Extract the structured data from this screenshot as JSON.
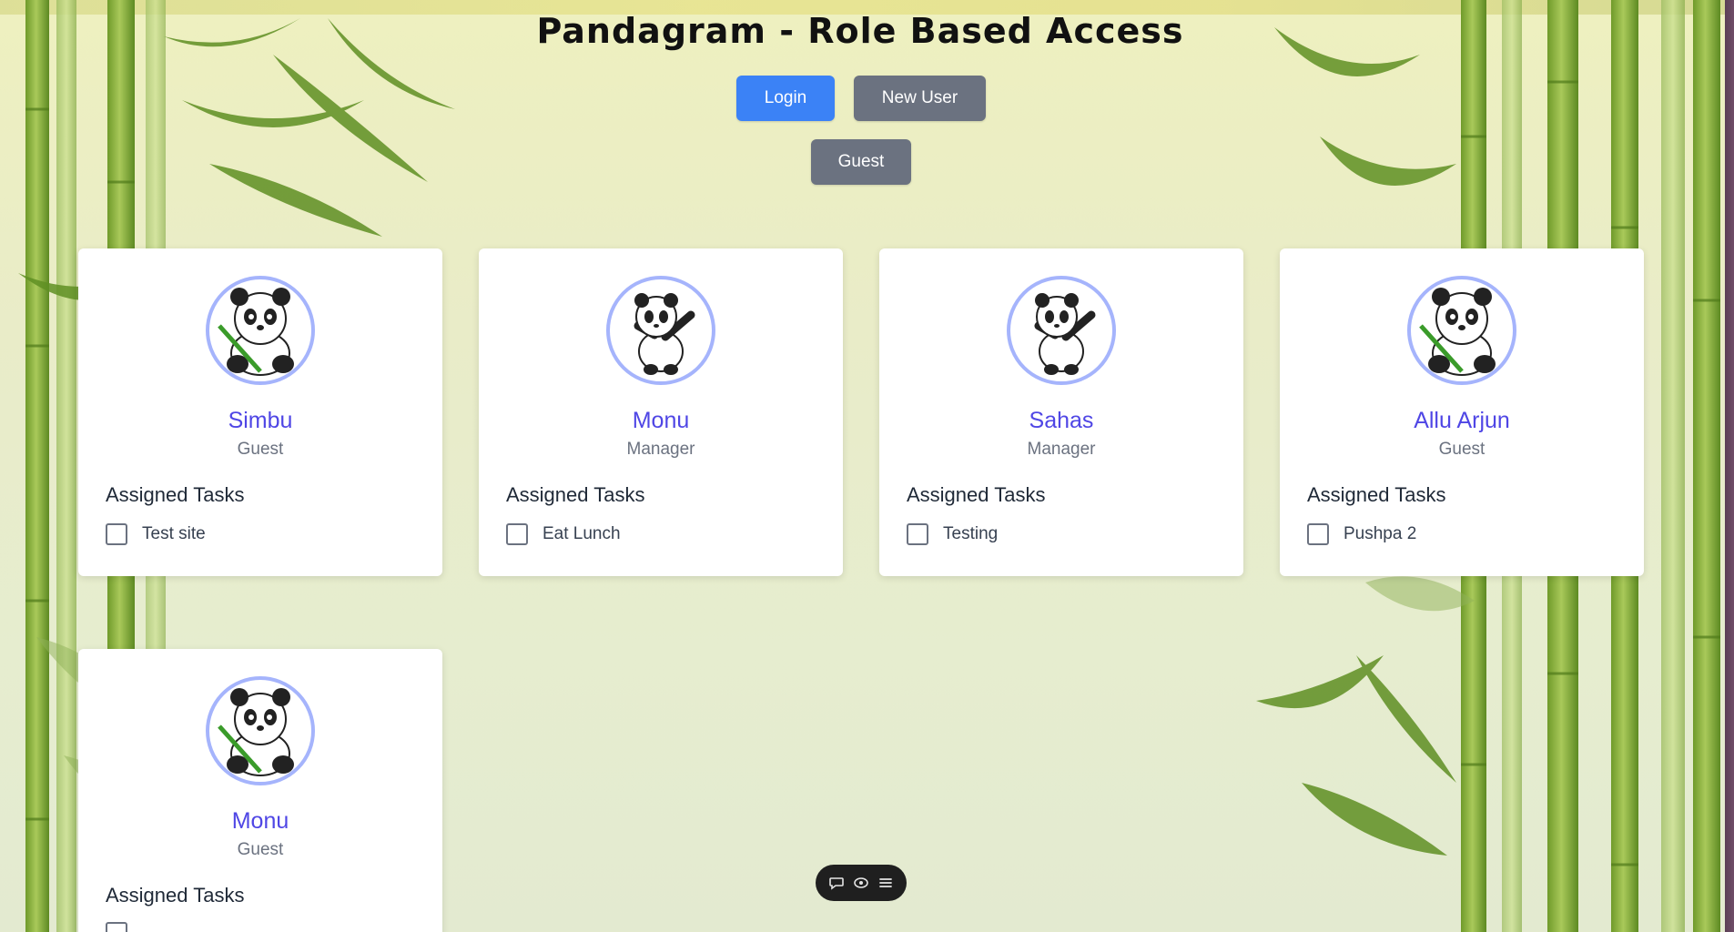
{
  "header": {
    "title": "Pandagram - Role Based Access"
  },
  "auth_buttons": {
    "login": "Login",
    "new_user": "New User",
    "guest": "Guest"
  },
  "users": [
    {
      "name": "Simbu",
      "role": "Guest",
      "tasks_heading": "Assigned Tasks",
      "task": "Test site",
      "avatar_icon": "panda-bamboo-icon"
    },
    {
      "name": "Monu",
      "role": "Manager",
      "tasks_heading": "Assigned Tasks",
      "task": "Eat Lunch",
      "avatar_icon": "panda-dab-icon"
    },
    {
      "name": "Sahas",
      "role": "Manager",
      "tasks_heading": "Assigned Tasks",
      "task": "Testing",
      "avatar_icon": "panda-dab-icon"
    },
    {
      "name": "Allu Arjun",
      "role": "Guest",
      "tasks_heading": "Assigned Tasks",
      "task": "Pushpa 2",
      "avatar_icon": "panda-bamboo-icon"
    },
    {
      "name": "Monu",
      "role": "Guest",
      "tasks_heading": "Assigned Tasks",
      "task": "",
      "avatar_icon": "panda-bamboo-icon"
    }
  ],
  "toolbar": {
    "icons": [
      "chat-icon",
      "eye-icon",
      "menu-icon"
    ]
  },
  "colors": {
    "primary_button": "#3b82f6",
    "secondary_button": "#6b7280",
    "user_name": "#4f46e5",
    "avatar_border": "#a5b4fc"
  }
}
